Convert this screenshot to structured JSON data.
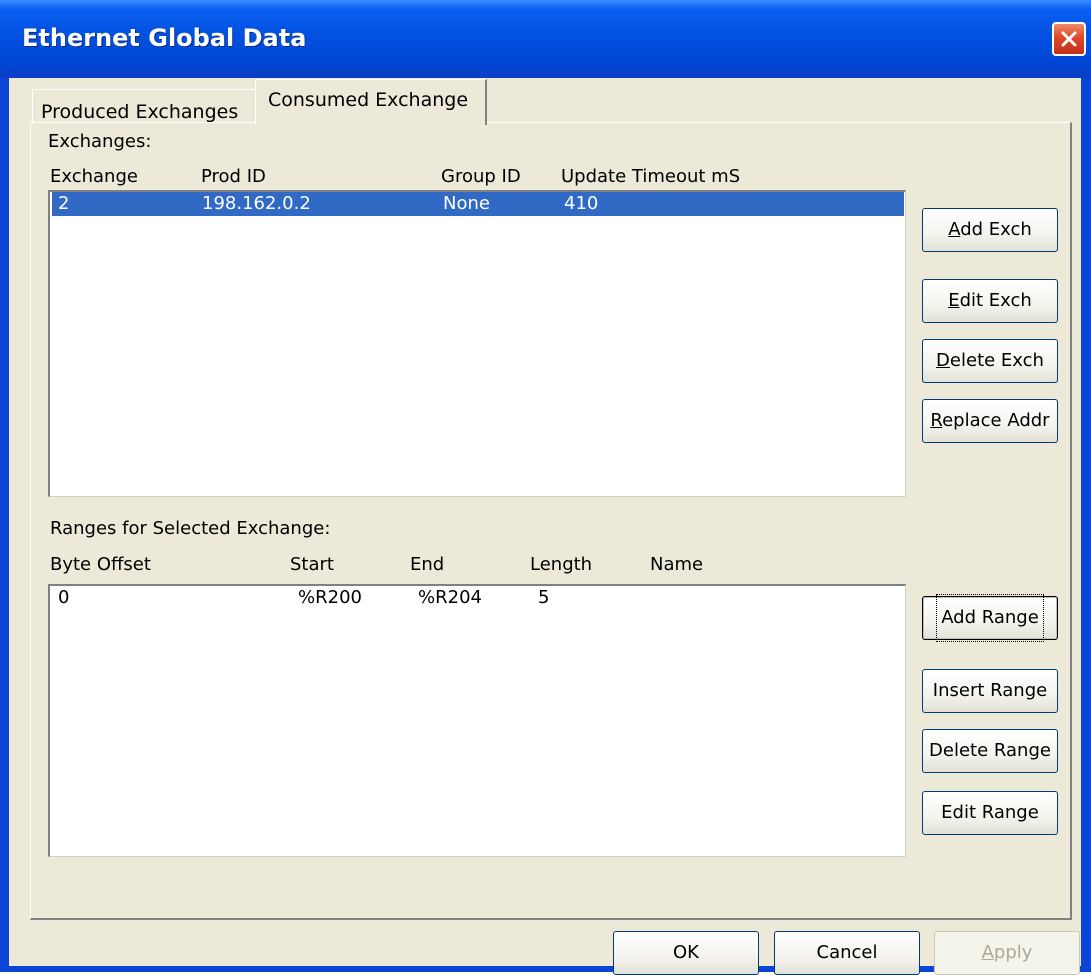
{
  "window": {
    "title": "Ethernet Global Data"
  },
  "tabs": [
    {
      "label": "Produced Exchanges",
      "active": false
    },
    {
      "label": "Consumed Exchange",
      "active": true
    }
  ],
  "exchanges": {
    "section_label": "Exchanges:",
    "columns": [
      "Exchange",
      "Prod ID",
      "Group ID",
      "Update Timeout mS"
    ],
    "rows": [
      {
        "exchange": "2",
        "prod_id": "198.162.0.2",
        "group_id": "None",
        "timeout": "410",
        "selected": true
      }
    ],
    "buttons": {
      "add": {
        "pre": "",
        "acc": "A",
        "post": "dd Exch"
      },
      "edit": {
        "pre": "",
        "acc": "E",
        "post": "dit Exch"
      },
      "delete": {
        "pre": "",
        "acc": "D",
        "post": "elete Exch"
      },
      "replace": {
        "pre": "",
        "acc": "R",
        "post": "eplace Addr"
      }
    }
  },
  "ranges": {
    "section_label": "Ranges for Selected Exchange:",
    "columns": [
      "Byte Offset",
      "Start",
      "End",
      "Length",
      "Name"
    ],
    "rows": [
      {
        "offset": "0",
        "start": "%R200",
        "end": "%R204",
        "length": "5",
        "name": ""
      }
    ],
    "buttons": {
      "add": "Add Range",
      "insert": "Insert Range",
      "delete": "Delete Range",
      "edit": "Edit Range"
    }
  },
  "footer": {
    "ok": "OK",
    "cancel": "Cancel",
    "apply_acc": "A",
    "apply_rest": "pply"
  },
  "colors": {
    "title_bar": "#0054e3",
    "selection": "#316ac5",
    "dialog_face": "#ece9d8",
    "close_button": "#e0462a"
  }
}
